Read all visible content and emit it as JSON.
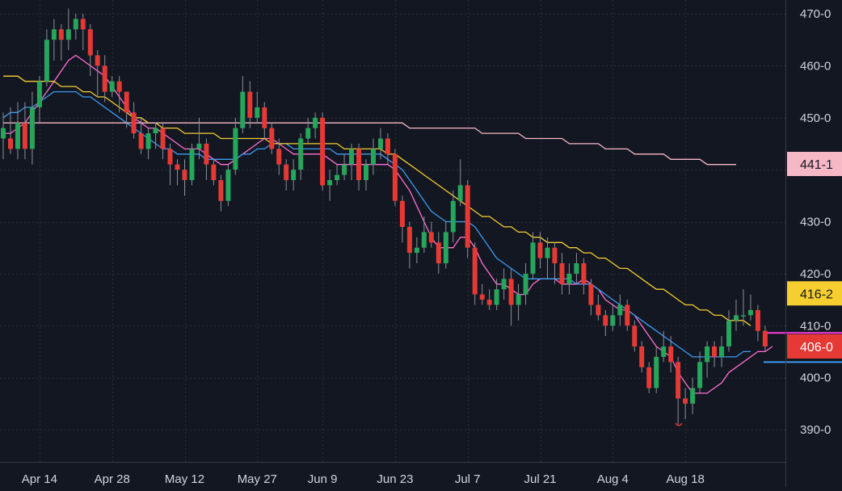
{
  "chart_data": {
    "type": "candlestick",
    "title": "",
    "ylim": [
      385,
      472
    ],
    "y_ticks": [
      390,
      400,
      410,
      420,
      430,
      440,
      450,
      460,
      470
    ],
    "y_tick_labels": [
      "390-0",
      "400-0",
      "410-0",
      "420-0",
      "430-0",
      "",
      "450-0",
      "460-0",
      "470-0"
    ],
    "x_labels": [
      {
        "label": "Apr 14",
        "index": 5
      },
      {
        "label": "Apr 28",
        "index": 15
      },
      {
        "label": "May 12",
        "index": 25
      },
      {
        "label": "May 27",
        "index": 35
      },
      {
        "label": "Jun 9",
        "index": 44
      },
      {
        "label": "Jun 23",
        "index": 54
      },
      {
        "label": "Jul 7",
        "index": 64
      },
      {
        "label": "Jul 21",
        "index": 74
      },
      {
        "label": "Aug 4",
        "index": 84
      },
      {
        "label": "Aug 18",
        "index": 94
      }
    ],
    "n_slots": 103,
    "candles": [
      [
        446,
        448,
        451,
        442
      ],
      [
        446,
        444,
        452,
        443
      ],
      [
        444,
        449,
        453,
        442
      ],
      [
        449,
        444,
        453,
        442
      ],
      [
        444,
        452,
        455,
        441
      ],
      [
        452,
        457,
        458,
        449
      ],
      [
        457,
        465,
        467,
        456
      ],
      [
        465,
        467,
        469,
        461
      ],
      [
        467,
        465,
        468,
        461
      ],
      [
        465,
        467,
        471,
        463
      ],
      [
        467,
        469,
        470,
        465
      ],
      [
        469,
        467,
        470,
        463
      ],
      [
        467,
        462,
        468,
        458
      ],
      [
        462,
        460,
        463,
        454
      ],
      [
        460,
        455,
        462,
        453
      ],
      [
        455,
        457,
        458,
        454
      ],
      [
        457,
        455,
        458,
        451
      ],
      [
        455,
        451,
        455,
        448
      ],
      [
        451,
        447,
        453,
        446
      ],
      [
        447,
        444,
        450,
        443
      ],
      [
        444,
        447,
        448,
        442
      ],
      [
        447,
        448,
        449,
        444
      ],
      [
        448,
        444,
        449,
        442
      ],
      [
        444,
        441,
        445,
        437
      ],
      [
        441,
        440,
        442,
        437
      ],
      [
        440,
        438,
        442,
        435
      ],
      [
        438,
        444,
        445,
        437
      ],
      [
        444,
        445,
        450,
        442
      ],
      [
        445,
        441,
        446,
        438
      ],
      [
        441,
        438,
        442,
        437
      ],
      [
        438,
        434,
        439,
        432
      ],
      [
        434,
        440,
        441,
        433
      ],
      [
        440,
        448,
        450,
        439
      ],
      [
        448,
        455,
        458,
        447
      ],
      [
        455,
        450,
        457,
        448
      ],
      [
        450,
        452,
        455,
        449
      ],
      [
        452,
        448,
        453,
        446
      ],
      [
        448,
        444,
        449,
        443
      ],
      [
        444,
        441,
        446,
        439
      ],
      [
        441,
        438,
        442,
        436
      ],
      [
        438,
        440,
        442,
        436
      ],
      [
        440,
        446,
        447,
        438
      ],
      [
        446,
        448,
        450,
        445
      ],
      [
        448,
        450,
        451,
        446
      ],
      [
        450,
        437,
        451,
        436
      ],
      [
        437,
        438,
        440,
        434
      ],
      [
        438,
        439,
        441,
        437
      ],
      [
        439,
        441,
        443,
        438
      ],
      [
        441,
        444,
        445,
        438
      ],
      [
        444,
        438,
        445,
        436
      ],
      [
        438,
        441,
        442,
        436
      ],
      [
        441,
        444,
        446,
        439
      ],
      [
        444,
        446,
        448,
        442
      ],
      [
        446,
        443,
        447,
        441
      ],
      [
        443,
        434,
        444,
        433
      ],
      [
        434,
        429,
        435,
        426
      ],
      [
        429,
        424,
        430,
        421
      ],
      [
        424,
        425,
        427,
        422
      ],
      [
        425,
        428,
        431,
        424
      ],
      [
        428,
        426,
        430,
        425
      ],
      [
        426,
        422,
        428,
        420
      ],
      [
        422,
        428,
        430,
        421
      ],
      [
        428,
        434,
        436,
        426
      ],
      [
        434,
        437,
        442,
        433
      ],
      [
        437,
        425,
        438,
        423
      ],
      [
        425,
        416,
        426,
        414
      ],
      [
        416,
        415,
        418,
        414
      ],
      [
        415,
        414,
        417,
        413
      ],
      [
        414,
        417,
        419,
        413
      ],
      [
        417,
        419,
        421,
        415
      ],
      [
        419,
        414,
        421,
        410
      ],
      [
        414,
        416,
        418,
        411
      ],
      [
        416,
        420,
        422,
        414
      ],
      [
        420,
        426,
        428,
        419
      ],
      [
        426,
        423,
        428,
        421
      ],
      [
        423,
        425,
        427,
        419
      ],
      [
        425,
        422,
        426,
        418
      ],
      [
        422,
        418,
        424,
        416
      ],
      [
        418,
        420,
        422,
        416
      ],
      [
        420,
        422,
        424,
        418
      ],
      [
        422,
        418,
        423,
        416
      ],
      [
        418,
        414,
        419,
        412
      ],
      [
        414,
        412,
        416,
        411
      ],
      [
        412,
        410,
        413,
        408
      ],
      [
        410,
        412,
        414,
        409
      ],
      [
        412,
        414,
        416,
        410
      ],
      [
        414,
        410,
        415,
        409
      ],
      [
        410,
        406,
        411,
        405
      ],
      [
        406,
        402,
        407,
        401
      ],
      [
        402,
        398,
        403,
        397
      ],
      [
        398,
        404,
        406,
        397
      ],
      [
        404,
        406,
        409,
        403
      ],
      [
        406,
        403,
        408,
        401
      ],
      [
        403,
        396,
        404,
        391
      ],
      [
        396,
        395,
        398,
        392
      ],
      [
        395,
        398,
        400,
        393
      ],
      [
        398,
        403,
        405,
        397
      ],
      [
        403,
        406,
        407,
        400
      ],
      [
        406,
        404,
        407,
        402
      ],
      [
        404,
        406,
        408,
        402
      ],
      [
        406,
        411,
        413,
        405
      ],
      [
        411,
        412,
        415,
        409
      ],
      [
        412,
        412,
        417,
        410
      ],
      [
        412,
        413,
        416,
        411
      ],
      [
        413,
        409,
        414,
        407
      ],
      [
        409,
        406,
        410,
        405
      ]
    ],
    "series": [
      {
        "type": "line",
        "color": "#ff6fd2",
        "values": [
          447,
          447,
          448,
          449,
          451,
          453,
          455,
          457,
          459,
          461,
          462,
          461,
          460,
          459,
          458,
          456,
          454,
          452,
          450,
          449,
          448,
          448,
          447,
          446,
          445,
          444,
          444,
          444,
          443,
          442,
          441,
          441,
          442,
          443,
          444,
          445,
          446,
          446,
          445,
          444,
          443,
          443,
          443,
          443,
          443,
          442,
          441,
          441,
          441,
          441,
          441,
          441,
          441,
          441,
          440,
          438,
          436,
          433,
          430,
          427,
          425,
          425,
          425,
          427,
          427,
          425,
          422,
          420,
          418,
          418,
          417,
          416,
          416,
          418,
          419,
          419,
          419,
          418,
          418,
          418,
          419,
          418,
          417,
          415,
          414,
          413,
          413,
          412,
          410,
          408,
          406,
          405,
          404,
          401,
          399,
          397,
          397,
          397,
          398,
          399,
          401,
          402,
          403,
          404,
          405,
          405,
          406
        ]
      },
      {
        "type": "line",
        "color": "#3d9bf0",
        "values": [
          450,
          451,
          451,
          452,
          452,
          453,
          454,
          455,
          455,
          455,
          455,
          454,
          454,
          453,
          452,
          451,
          450,
          449,
          448,
          447,
          446,
          445,
          444,
          444,
          443,
          443,
          443,
          443,
          442,
          442,
          442,
          442,
          442,
          443,
          443,
          444,
          444,
          445,
          445,
          445,
          444,
          444,
          444,
          444,
          444,
          444,
          443,
          443,
          443,
          443,
          443,
          443,
          443,
          442,
          441,
          440,
          438,
          436,
          434,
          432,
          431,
          430,
          430,
          430,
          430,
          429,
          427,
          425,
          423,
          422,
          421,
          420,
          419,
          419,
          419,
          419,
          419,
          419,
          419,
          418,
          418,
          418,
          417,
          416,
          415,
          414,
          413,
          412,
          411,
          410,
          409,
          408,
          407,
          406,
          405,
          404,
          404,
          404,
          404,
          404,
          404,
          404,
          405,
          405
        ]
      },
      {
        "type": "line",
        "color": "#f6ce30",
        "values": [
          458,
          458,
          458,
          457,
          457,
          457,
          457,
          457,
          456,
          456,
          456,
          455,
          455,
          454,
          454,
          453,
          452,
          451,
          450,
          450,
          449,
          449,
          448,
          448,
          448,
          447,
          447,
          447,
          447,
          447,
          446,
          446,
          446,
          446,
          446,
          446,
          446,
          445,
          445,
          445,
          445,
          445,
          445,
          445,
          445,
          445,
          445,
          444,
          444,
          444,
          444,
          444,
          444,
          443,
          443,
          442,
          441,
          440,
          439,
          438,
          437,
          436,
          435,
          434,
          433,
          432,
          431,
          431,
          430,
          429,
          429,
          428,
          428,
          427,
          427,
          426,
          426,
          426,
          425,
          425,
          424,
          424,
          423,
          423,
          422,
          421,
          421,
          420,
          419,
          418,
          417,
          417,
          416,
          415,
          414,
          414,
          413,
          413,
          412,
          412,
          411,
          411,
          411,
          410
        ]
      },
      {
        "type": "line",
        "color": "#f7b8c6",
        "values": [
          449,
          449,
          449,
          449,
          449,
          449,
          449,
          449,
          449,
          449,
          449,
          449,
          449,
          449,
          449,
          449,
          449,
          449,
          449,
          449,
          449,
          449,
          449,
          449,
          449,
          449,
          449,
          449,
          449,
          449,
          449,
          449,
          449,
          449,
          449,
          449,
          449,
          449,
          449,
          449,
          449,
          449,
          449,
          449,
          449,
          449,
          449,
          449,
          449,
          449,
          449,
          449,
          449,
          449,
          449,
          449,
          448,
          448,
          448,
          448,
          448,
          448,
          448,
          448,
          448,
          448,
          447,
          447,
          447,
          447,
          447,
          447,
          446,
          446,
          446,
          446,
          446,
          446,
          445,
          445,
          445,
          445,
          445,
          444,
          444,
          444,
          444,
          443,
          443,
          443,
          443,
          443,
          442,
          442,
          442,
          442,
          442,
          441,
          441,
          441,
          441,
          441
        ]
      }
    ],
    "price_tags": [
      {
        "label": "441-1",
        "price": 441.1,
        "bg": "#f7b8c6",
        "fg": "#131722"
      },
      {
        "label": "416-2",
        "price": 416.2,
        "bg": "#f6ce30",
        "fg": "#131722"
      },
      {
        "label": "406-0",
        "price": 406.0,
        "bg": "#e53935",
        "fg": "#ffffff"
      }
    ],
    "h_lines": [
      {
        "price": 408.6,
        "color": "#ff3de0"
      },
      {
        "price": 403.0,
        "color": "#3d9bf0"
      }
    ],
    "colors": {
      "background": "#131722",
      "grid": "#2a2e39",
      "up": "#26a65b",
      "down": "#e53935",
      "wick": "#8a8f98",
      "axis_text": "#d1d4dc"
    }
  }
}
